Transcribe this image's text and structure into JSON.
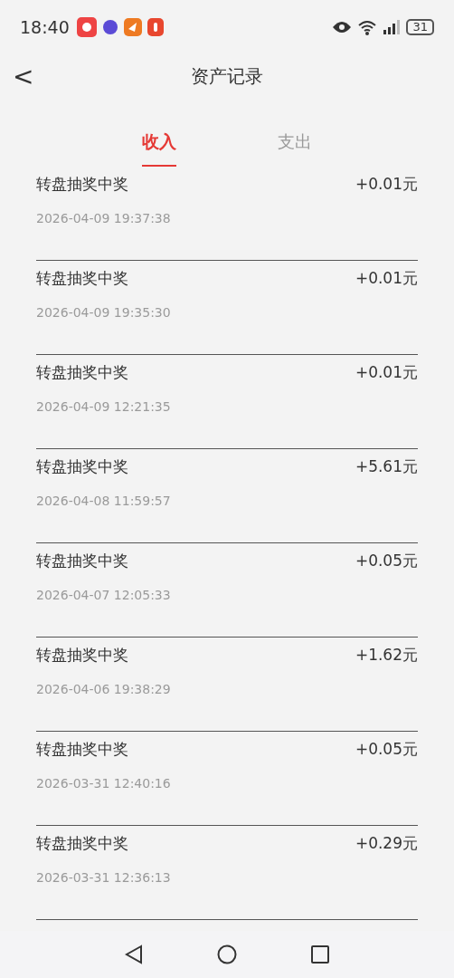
{
  "status_bar": {
    "time": "18:40",
    "battery": "31"
  },
  "header": {
    "back": "<",
    "title": "资产记录"
  },
  "tabs": [
    {
      "label": "收入",
      "selected": true
    },
    {
      "label": "支出",
      "selected": false
    }
  ],
  "records": [
    {
      "title": "转盘抽奖中奖",
      "amount": "+0.01元",
      "time": "2026-04-09 19:37:38"
    },
    {
      "title": "转盘抽奖中奖",
      "amount": "+0.01元",
      "time": "2026-04-09 19:35:30"
    },
    {
      "title": "转盘抽奖中奖",
      "amount": "+0.01元",
      "time": "2026-04-09 12:21:35"
    },
    {
      "title": "转盘抽奖中奖",
      "amount": "+5.61元",
      "time": "2026-04-08 11:59:57"
    },
    {
      "title": "转盘抽奖中奖",
      "amount": "+0.05元",
      "time": "2026-04-07 12:05:33"
    },
    {
      "title": "转盘抽奖中奖",
      "amount": "+1.62元",
      "time": "2026-04-06 19:38:29"
    },
    {
      "title": "转盘抽奖中奖",
      "amount": "+0.05元",
      "time": "2026-03-31 12:40:16"
    },
    {
      "title": "转盘抽奖中奖",
      "amount": "+0.29元",
      "time": "2026-03-31 12:36:13"
    }
  ]
}
